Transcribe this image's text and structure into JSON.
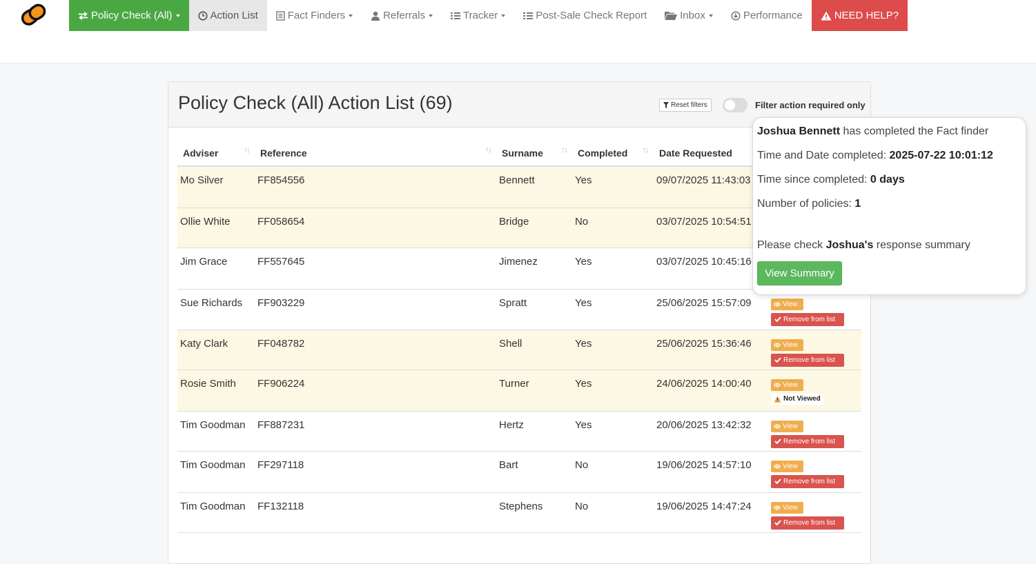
{
  "nav": {
    "items": [
      {
        "label": "Policy Check (All)",
        "icon": "exchange-arrows-icon",
        "caret": true,
        "state": "active-green"
      },
      {
        "label": "Action List",
        "icon": "clock-icon",
        "caret": false,
        "state": "active-grey"
      },
      {
        "label": "Fact Finders",
        "icon": "document-icon",
        "caret": true,
        "state": ""
      },
      {
        "label": "Referrals",
        "icon": "user-icon",
        "caret": true,
        "state": ""
      },
      {
        "label": "Tracker",
        "icon": "list-icon",
        "caret": true,
        "state": ""
      },
      {
        "label": "Post-Sale Check Report",
        "icon": "list-icon",
        "caret": false,
        "state": ""
      },
      {
        "label": "Inbox",
        "icon": "folder-open-icon",
        "caret": true,
        "state": ""
      },
      {
        "label": "Performance",
        "icon": "download-circle-icon",
        "caret": false,
        "state": ""
      },
      {
        "label": "NEED HELP?",
        "icon": "warning-icon",
        "caret": false,
        "state": "help"
      }
    ]
  },
  "panel": {
    "title": "Policy Check (All) Action List (69)",
    "reset_filters_label": "Reset filters",
    "filter_label": "Filter action required only",
    "filter_enabled": false
  },
  "table": {
    "columns": [
      "Adviser",
      "Reference",
      "Surname",
      "Completed",
      "Date Requested"
    ],
    "rows": [
      {
        "adviser": "Mo Silver",
        "reference": "FF854556",
        "surname": "Bennett",
        "completed": "Yes",
        "date": "09/07/2025 11:43:03",
        "highlight": true,
        "actions": []
      },
      {
        "adviser": "Ollie White",
        "reference": "FF058654",
        "surname": "Bridge",
        "completed": "No",
        "date": "03/07/2025 10:54:51",
        "highlight": true,
        "actions": []
      },
      {
        "adviser": "Jim Grace",
        "reference": "FF557645",
        "surname": "Jimenez",
        "completed": "Yes",
        "date": "03/07/2025 10:45:16",
        "highlight": false,
        "actions": []
      },
      {
        "adviser": "Sue Richards",
        "reference": "FF903229",
        "surname": "Spratt",
        "completed": "Yes",
        "date": "25/06/2025 15:57:09",
        "highlight": false,
        "actions": [
          "view",
          "remove"
        ]
      },
      {
        "adviser": "Katy Clark",
        "reference": "FF048782",
        "surname": "Shell",
        "completed": "Yes",
        "date": "25/06/2025 15:36:46",
        "highlight": true,
        "actions": [
          "view",
          "remove"
        ]
      },
      {
        "adviser": "Rosie Smith",
        "reference": "FF906224",
        "surname": "Turner",
        "completed": "Yes",
        "date": "24/06/2025 14:00:40",
        "highlight": true,
        "actions": [
          "view",
          "not_viewed"
        ]
      },
      {
        "adviser": "Tim Goodman",
        "reference": "FF887231",
        "surname": "Hertz",
        "completed": "Yes",
        "date": "20/06/2025 13:42:32",
        "highlight": false,
        "actions": [
          "view",
          "remove"
        ]
      },
      {
        "adviser": "Tim Goodman",
        "reference": "FF297118",
        "surname": "Bart",
        "completed": "No",
        "date": "19/06/2025 14:57:10",
        "highlight": false,
        "actions": [
          "view",
          "remove"
        ]
      },
      {
        "adviser": "Tim Goodman",
        "reference": "FF132118",
        "surname": "Stephens",
        "completed": "No",
        "date": "19/06/2025 14:47:24",
        "highlight": false,
        "actions": [
          "view",
          "remove"
        ]
      }
    ],
    "view_label": "View",
    "remove_label": "Remove from list",
    "not_viewed_label": "Not Viewed"
  },
  "popover": {
    "name": "Joshua Bennett",
    "completed_text": "has completed the Fact finder",
    "time_date_label": "Time and Date completed:",
    "time_date_value": "2025-07-22 10:01:12",
    "time_since_label": "Time since completed:",
    "time_since_value": "0 days",
    "policies_label": "Number of policies:",
    "policies_value": "1",
    "check_prefix": "Please check",
    "check_name": "Joshua's",
    "check_suffix": "response summary",
    "button_label": "View Summary"
  },
  "colors": {
    "primary_green": "#4aa843",
    "help_red": "#dd4b4b",
    "view_orange": "#f0ad4e",
    "remove_red": "#d9534f",
    "row_highlight": "#fcf8e3",
    "summary_green": "#5cb85c"
  }
}
